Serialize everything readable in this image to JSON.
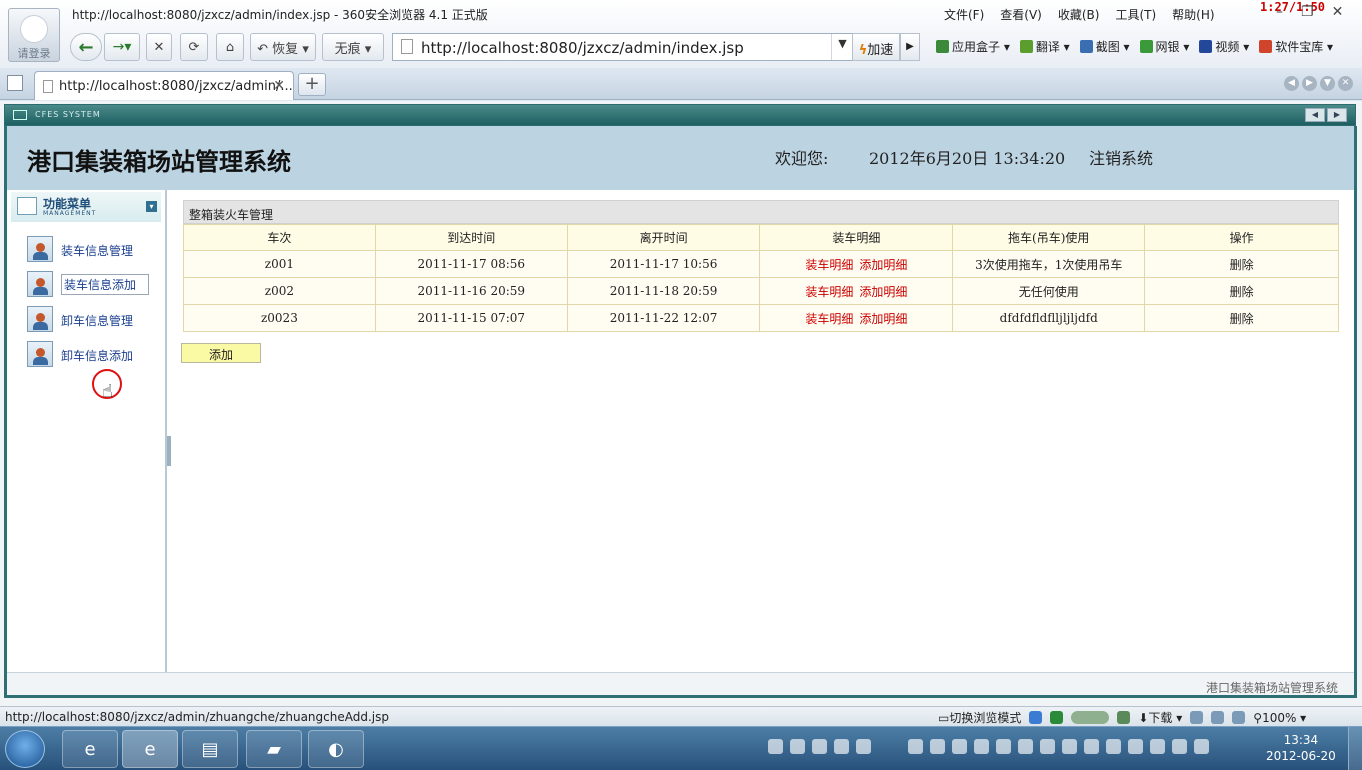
{
  "browser": {
    "window_title": "http://localhost:8080/jzxcz/admin/index.jsp - 360安全浏览器 4.1 正式版",
    "avatar_label": "请登录",
    "menu": [
      "文件(F)",
      "查看(V)",
      "收藏(B)",
      "工具(T)",
      "帮助(H)"
    ],
    "timer": "1:27/1:50",
    "nav": {
      "restore": "↶ 恢复 ▾",
      "private": "无痕 ▾"
    },
    "address": "http://localhost:8080/jzxcz/admin/index.jsp",
    "accelerate": "加速",
    "toolbar": [
      {
        "label": "应用盒子 ▾",
        "color": "#3a8a3a"
      },
      {
        "label": "翻译 ▾",
        "color": "#5c9e2e"
      },
      {
        "label": "截图 ▾",
        "color": "#3b6db3"
      },
      {
        "label": "网银 ▾",
        "color": "#3a9a3a"
      },
      {
        "label": "视频 ▾",
        "color": "#23489a"
      },
      {
        "label": "软件宝库 ▾",
        "color": "#d0442b"
      }
    ],
    "tab_title": "http://localhost:8080/jzxcz/admin/...",
    "status_url": "http://localhost:8080/jzxcz/admin/zhuangche/zhuangcheAdd.jsp",
    "status_mode": "切换浏览模式",
    "status_download": "下载 ▾",
    "zoom": "100% ▾"
  },
  "page": {
    "sys_bar_text": "CFES SYSTEM",
    "system_title": "港口集装箱场站管理系统",
    "welcome": "欢迎您:",
    "datetime": "2012年6月20日  13:34:20",
    "logout": "注销系统",
    "menu_title": "功能菜单",
    "menu_subtitle": "MANAGEMENT",
    "menu_items": [
      "装车信息管理",
      "装车信息添加",
      "卸车信息管理",
      "卸车信息添加"
    ],
    "panel_title": "整箱装火车管理",
    "columns": [
      "车次",
      "到达时间",
      "离开时间",
      "装车明细",
      "拖车(吊车)使用",
      "操作"
    ],
    "rows": [
      {
        "train": "z001",
        "arrive": "2011-11-17 08:56",
        "leave": "2011-11-17 10:56",
        "detail": "装车明细",
        "add_detail": "添加明细",
        "usage": "3次使用拖车，1次使用吊车",
        "op": "删除"
      },
      {
        "train": "z002",
        "arrive": "2011-11-16 20:59",
        "leave": "2011-11-18 20:59",
        "detail": "装车明细",
        "add_detail": "添加明细",
        "usage": "无任何使用",
        "op": "删除"
      },
      {
        "train": "z0023",
        "arrive": "2011-11-15 07:07",
        "leave": "2011-11-22 12:07",
        "detail": "装车明细",
        "add_detail": "添加明细",
        "usage": "dfdfdfldflljljljdfd",
        "op": "删除"
      }
    ],
    "add_button": "添加",
    "footer": "港口集装箱场站管理系统"
  },
  "taskbar": {
    "clock_time": "13:34",
    "clock_date": "2012-06-20"
  }
}
